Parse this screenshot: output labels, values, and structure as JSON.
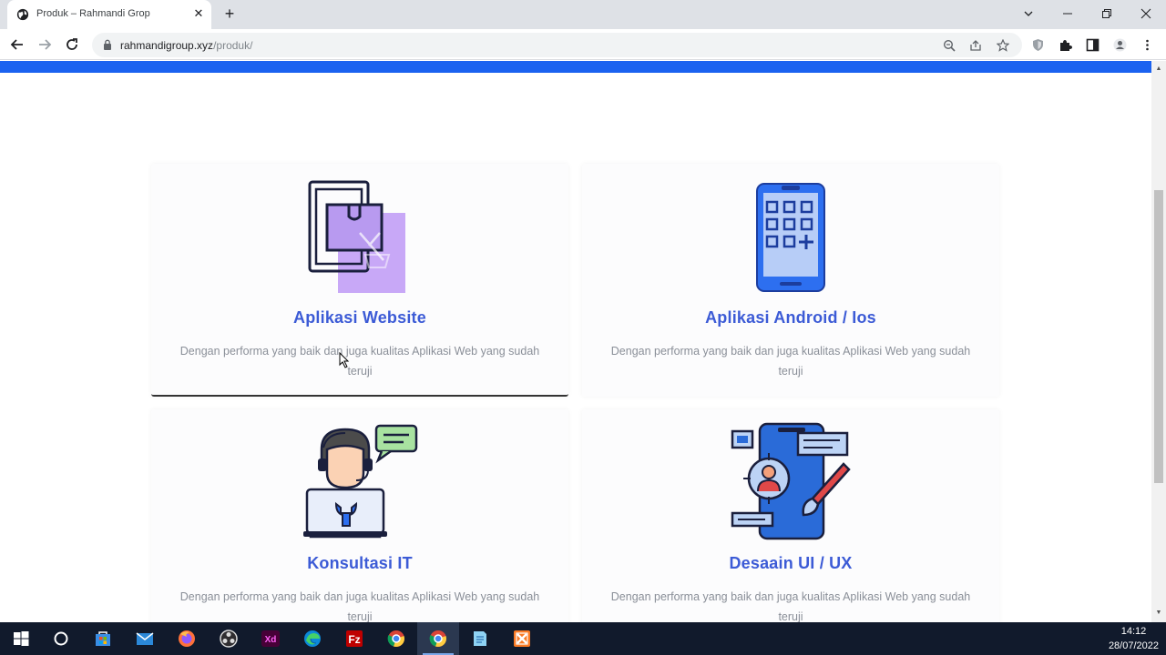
{
  "browser": {
    "tab": {
      "title": "Produk – Rahmandi Grop",
      "close": "✕"
    },
    "new_tab": "+",
    "url": {
      "host": "rahmandigroup.xyz",
      "path": "/produk/"
    }
  },
  "page": {
    "cards": [
      {
        "title": "Aplikasi Website",
        "description": "Dengan performa yang baik dan juga kualitas Aplikasi Web yang sudah teruji",
        "icon": "website-app-icon"
      },
      {
        "title": "Aplikasi Android / Ios",
        "description": "Dengan performa yang baik dan juga kualitas Aplikasi Web yang sudah teruji",
        "icon": "mobile-app-icon"
      },
      {
        "title": "Konsultasi IT",
        "description": "Dengan performa yang baik dan juga kualitas Aplikasi Web yang sudah teruji",
        "icon": "it-consultant-icon"
      },
      {
        "title": "Desaain UI / UX",
        "description": "Dengan performa yang baik dan juga kualitas Aplikasi Web yang sudah teruji",
        "icon": "ui-ux-design-icon"
      }
    ],
    "accent_color": "#1b62f0",
    "title_color": "#3c5bd6"
  },
  "taskbar": {
    "apps": [
      "windows-start-icon",
      "search-circle-icon",
      "store-icon",
      "mail-icon",
      "firefox-icon",
      "obs-icon",
      "adobe-xd-icon",
      "edge-icon",
      "filezilla-icon",
      "chrome-icon",
      "chrome-active-icon",
      "notepad-icon",
      "xampp-icon"
    ],
    "xd_label": "Xd",
    "fz_label": "Fz",
    "clock": {
      "time": "14:12",
      "date": "28/07/2022"
    }
  }
}
